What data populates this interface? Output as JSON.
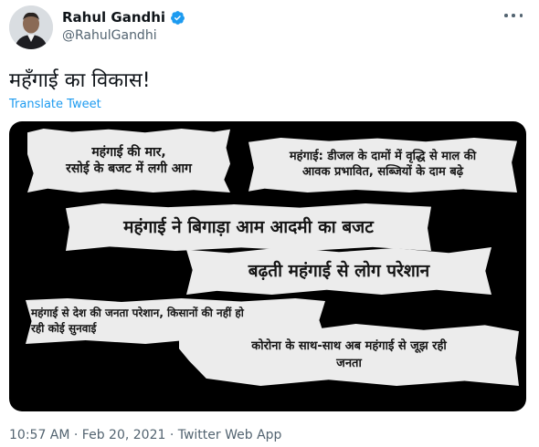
{
  "tweet": {
    "display_name": "Rahul Gandhi",
    "handle": "@RahulGandhi",
    "verified": true,
    "text": "महँगाई का विकास!",
    "translate_label": "Translate Tweet",
    "meta": "10:57 AM · Feb 20, 2021 · Twitter Web App",
    "accent_color": "#1d9bf0"
  },
  "media": {
    "clippings": [
      {
        "lines": [
          "महंगाई की मार,",
          "रसोई के बजट में लगी आग"
        ]
      },
      {
        "lines": [
          "महंगाई: डीजल के दामों में वृद्धि से माल की",
          "आवक प्रभावित, सब्जियों के दाम बढ़े"
        ]
      },
      {
        "lines": [
          "महंगाई ने बिगाड़ा आम आदमी का बजट"
        ]
      },
      {
        "lines": [
          "बढ़ती महंगाई से लोग परेशान"
        ]
      },
      {
        "lines": [
          "महंगाई से देश की जनता परेशान, किसानों की नहीं हो",
          "रही कोई सुनवाई"
        ]
      },
      {
        "lines": [
          "कोरोना के साथ-साथ अब महंगाई से जूझ रही",
          "जनता"
        ]
      }
    ]
  },
  "icons": [
    "verified-badge-icon",
    "more-options-icon"
  ]
}
